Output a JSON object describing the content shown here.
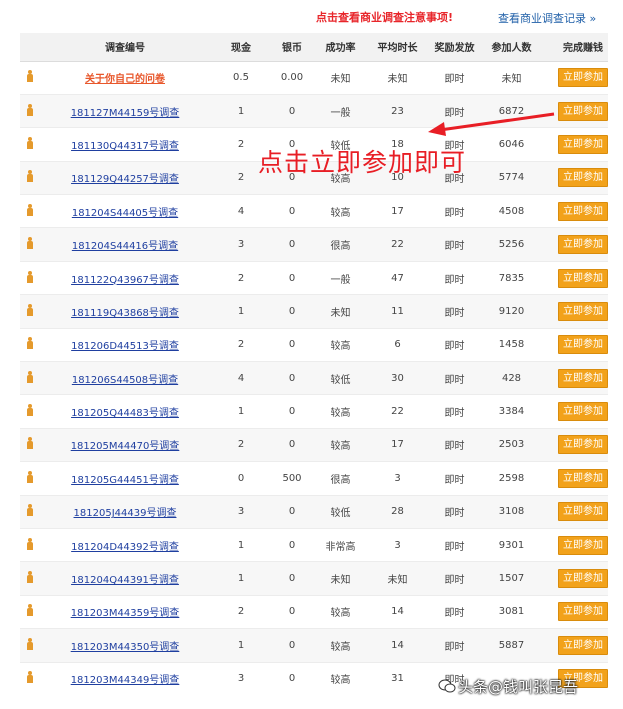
{
  "header": {
    "notice": "点击查看商业调查注意事项!",
    "records_link": "查看商业调查记录 »"
  },
  "columns": [
    "调查编号",
    "现金",
    "银币",
    "成功率",
    "平均时长",
    "奖励发放",
    "参加人数",
    "完成赚钱"
  ],
  "rows": [
    {
      "id": "关于你自己的问卷",
      "cash": "0.5",
      "silver": "0.00",
      "rate": "未知",
      "time": "未知",
      "reward": "即时",
      "people": "未知",
      "button": "立即参加",
      "own": true
    },
    {
      "id": "181127M44159号调查",
      "cash": "1",
      "silver": "0",
      "rate": "一般",
      "time": "23",
      "reward": "即时",
      "people": "6872",
      "button": "立即参加"
    },
    {
      "id": "181130Q44317号调查",
      "cash": "2",
      "silver": "0",
      "rate": "较低",
      "time": "18",
      "reward": "即时",
      "people": "6046",
      "button": "立即参加"
    },
    {
      "id": "181129Q44257号调查",
      "cash": "2",
      "silver": "0",
      "rate": "较高",
      "time": "10",
      "reward": "即时",
      "people": "5774",
      "button": "立即参加"
    },
    {
      "id": "181204S44405号调查",
      "cash": "4",
      "silver": "0",
      "rate": "较高",
      "time": "17",
      "reward": "即时",
      "people": "4508",
      "button": "立即参加"
    },
    {
      "id": "181204S44416号调查",
      "cash": "3",
      "silver": "0",
      "rate": "很高",
      "time": "22",
      "reward": "即时",
      "people": "5256",
      "button": "立即参加"
    },
    {
      "id": "181122Q43967号调查",
      "cash": "2",
      "silver": "0",
      "rate": "一般",
      "time": "47",
      "reward": "即时",
      "people": "7835",
      "button": "立即参加"
    },
    {
      "id": "181119Q43868号调查",
      "cash": "1",
      "silver": "0",
      "rate": "未知",
      "time": "11",
      "reward": "即时",
      "people": "9120",
      "button": "立即参加"
    },
    {
      "id": "181206D44513号调查",
      "cash": "2",
      "silver": "0",
      "rate": "较高",
      "time": "6",
      "reward": "即时",
      "people": "1458",
      "button": "立即参加"
    },
    {
      "id": "181206S44508号调查",
      "cash": "4",
      "silver": "0",
      "rate": "较低",
      "time": "30",
      "reward": "即时",
      "people": "428",
      "button": "立即参加"
    },
    {
      "id": "181205Q44483号调查",
      "cash": "1",
      "silver": "0",
      "rate": "较高",
      "time": "22",
      "reward": "即时",
      "people": "3384",
      "button": "立即参加"
    },
    {
      "id": "181205M44470号调查",
      "cash": "2",
      "silver": "0",
      "rate": "较高",
      "time": "17",
      "reward": "即时",
      "people": "2503",
      "button": "立即参加"
    },
    {
      "id": "181205G44451号调查",
      "cash": "0",
      "silver": "500",
      "rate": "很高",
      "time": "3",
      "reward": "即时",
      "people": "2598",
      "button": "立即参加"
    },
    {
      "id": "181205J44439号调查",
      "cash": "3",
      "silver": "0",
      "rate": "较低",
      "time": "28",
      "reward": "即时",
      "people": "3108",
      "button": "立即参加"
    },
    {
      "id": "181204D44392号调查",
      "cash": "1",
      "silver": "0",
      "rate": "非常高",
      "time": "3",
      "reward": "即时",
      "people": "9301",
      "button": "立即参加"
    },
    {
      "id": "181204Q44391号调查",
      "cash": "1",
      "silver": "0",
      "rate": "未知",
      "time": "未知",
      "reward": "即时",
      "people": "1507",
      "button": "立即参加"
    },
    {
      "id": "181203M44359号调查",
      "cash": "2",
      "silver": "0",
      "rate": "较高",
      "time": "14",
      "reward": "即时",
      "people": "3081",
      "button": "立即参加"
    },
    {
      "id": "181203M44350号调查",
      "cash": "1",
      "silver": "0",
      "rate": "较高",
      "time": "14",
      "reward": "即时",
      "people": "5887",
      "button": "立即参加"
    },
    {
      "id": "181203M44349号调查",
      "cash": "3",
      "silver": "0",
      "rate": "较高",
      "time": "31",
      "reward": "即时",
      "people": "",
      "button": "立即参加"
    }
  ],
  "annotation": {
    "text": "点击立即参加即可",
    "color": "#e81e25"
  },
  "watermark": "头条@钱叫张昆吾",
  "colors": {
    "button": "#f2a21b",
    "link": "#1f3fa0",
    "notice": "#e8262b"
  }
}
